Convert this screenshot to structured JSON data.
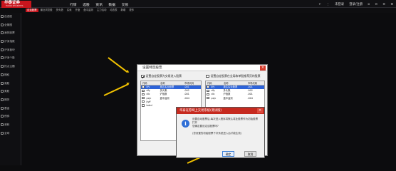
{
  "app": {
    "logo_text": "华泰证券",
    "logo_sub": "HUATAI SECURITIES"
  },
  "menu": [
    "行情",
    "选股",
    "资讯",
    "数据",
    "交易"
  ],
  "top_right": {
    "back_glyph": "←",
    "ellipsis": "⋮",
    "login": "未登录",
    "user_login": "登录/注册",
    "icons": [
      "o",
      "⊙",
      "≡",
      "⊕"
    ]
  },
  "sub_tabs": [
    "自选股票",
    "最近浏览股",
    "多头趋",
    "买卖",
    "开盘",
    "盘中监测",
    "主力活动",
    "动态表",
    "新增",
    "更多"
  ],
  "sidebar": [
    {
      "label": "自选股",
      "icon": "star-icon"
    },
    {
      "label": "全景图",
      "icon": "grid-icon"
    },
    {
      "label": "我的股票",
      "icon": "folder-icon"
    },
    {
      "label": "沪深指数",
      "icon": "chart-icon"
    },
    {
      "label": "沪深板块",
      "icon": "layers-icon"
    },
    {
      "label": "沪深个股",
      "icon": "list-icon"
    },
    {
      "label": "热点主题",
      "icon": "fire-icon"
    },
    {
      "label": "期权",
      "icon": "option-icon"
    },
    {
      "label": "港股",
      "icon": "hk-icon"
    },
    {
      "label": "美股",
      "icon": "us-icon"
    },
    {
      "label": "期货",
      "icon": "futures-icon"
    },
    {
      "label": "基金",
      "icon": "fund-icon"
    },
    {
      "label": "债券",
      "icon": "bond-icon"
    },
    {
      "label": "滚转",
      "icon": "refresh-icon"
    },
    {
      "label": "全球",
      "icon": "globe-icon"
    }
  ],
  "dialog_main": {
    "title": "设置特定股票",
    "opt_left": "设置自定股票为交易进入股票",
    "opt_right": "设置自定股票在全局和单股推荐页的股票",
    "left_headers": [
      "代码",
      "名称",
      "市场代码"
    ],
    "left_rows": [
      {
        "code": "ljfy",
        "name": "奥达实业股票",
        "mkt": ".001",
        "checked": true
      },
      {
        "code": "dfy",
        "name": "多头集",
        "mkt": ".002",
        "checked": true
      },
      {
        "code": "clb",
        "name": "沪指数",
        "mkt": ".001",
        "checked": true
      },
      {
        "code": "pxjc",
        "name": "盘中监测",
        "mkt": ".004",
        "checked": true
      },
      {
        "code": "jlyff",
        "name": "",
        "mkt": "",
        "checked": true
      },
      {
        "code": "bdcd",
        "name": "",
        "mkt": "",
        "checked": true
      }
    ],
    "right_headers": [
      "代码",
      "名称",
      "市场代码"
    ],
    "right_rows": [
      {
        "code": "ljfy",
        "name": "奥达实业股票",
        "mkt": ".001",
        "checked": true
      },
      {
        "code": "dfy",
        "name": "多头集",
        "mkt": ".002",
        "checked": true
      },
      {
        "code": "clb",
        "name": "沪指数",
        "mkt": ".001",
        "checked": true
      },
      {
        "code": "pxjc",
        "name": "盘中监测",
        "mkt": ".004",
        "checked": true
      }
    ]
  },
  "dialog_confirm": {
    "title": "华泰证券网上交易系统(测试版)",
    "message_lines": [
      "设置自动股票后,每次进入程序将默认将此股票作为初始股票",
      "打开",
      "您确定要设定该股票吗?",
      "",
      "(您设置的初始股票下次系统进入后才能生效)"
    ],
    "ok": "确定",
    "cancel": "取消"
  },
  "colors": {
    "brand_red": "#c8151d",
    "arrow": "#f2c200",
    "selection": "#2d63d8"
  }
}
